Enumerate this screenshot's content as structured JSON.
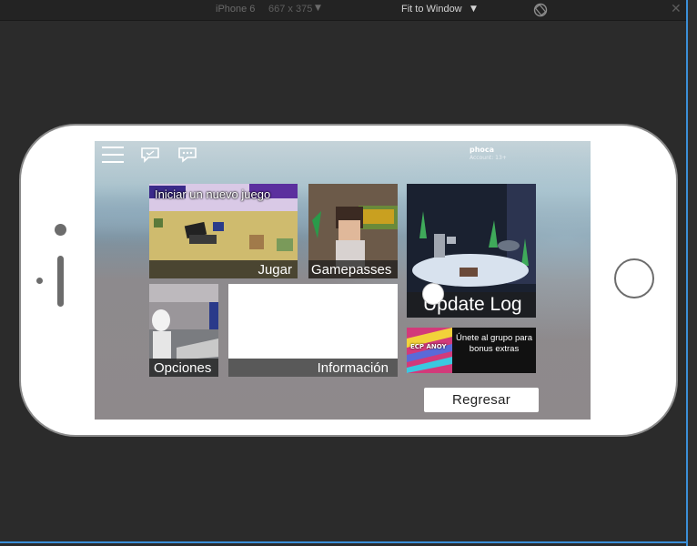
{
  "toolbar": {
    "device": "iPhone 6",
    "dimensions": "667 x 375",
    "zoom": "Fit to Window"
  },
  "game": {
    "user": {
      "name": "phoca",
      "account": "Account: 13+"
    },
    "tiles": {
      "new_game_banner": "Iniciar un nuevo juego",
      "play": "Jugar",
      "gamepasses": "Gamepasses",
      "update_log": "Update Log",
      "options": "Opciones",
      "info": "Información",
      "group_promo": "Únete al grupo para bonus extras",
      "group_logo_text": "ECP ANOY"
    },
    "back_button": "Regresar"
  },
  "colors": {
    "accent_border": "#3b8fd8",
    "phone_frame": "#ffffff",
    "tile_caption_bg": "#1e1e1e"
  },
  "icons": [
    "menu-icon",
    "feedback-icon",
    "chat-icon",
    "rotate-icon",
    "close-icon",
    "home-button"
  ]
}
